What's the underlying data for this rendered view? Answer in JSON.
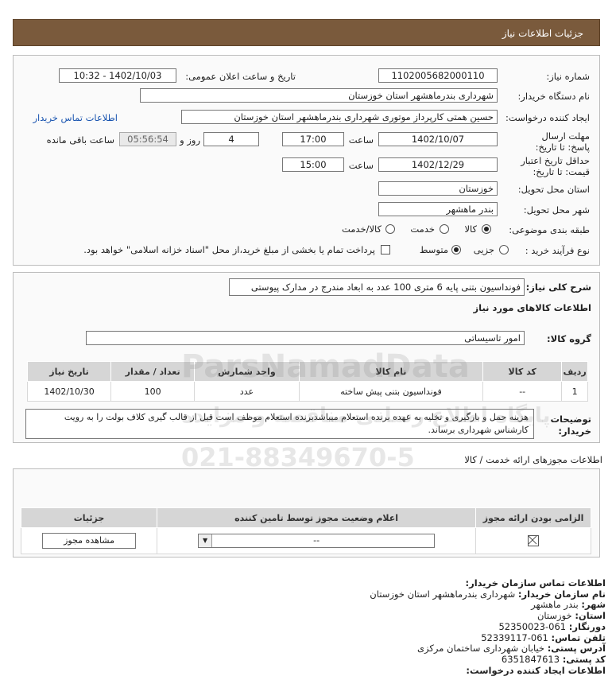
{
  "header": {
    "title": "جزئیات اطلاعات نیاز"
  },
  "details": {
    "need_number_label": "شماره نیاز:",
    "need_number": "1102005682000110",
    "announce_label": "تاریخ و ساعت اعلان عمومی:",
    "announce_value": "1402/10/03 - 10:32",
    "buyer_org_label": "نام دستگاه خریدار:",
    "buyer_org": "شهرداری بندرماهشهر استان خوزستان",
    "creator_label": "ایجاد کننده درخواست:",
    "creator": "حسین همتی کارپرداز موتوری شهرداری بندرماهشهر استان خوزستان",
    "buyer_contact_link": "اطلاعات تماس خریدار",
    "reply_deadline_label": "مهلت ارسال پاسخ: تا تاریخ:",
    "reply_date": "1402/10/07",
    "time_label": "ساعت",
    "reply_time": "17:00",
    "days": "4",
    "days_label": "روز و",
    "remaining_time": "05:56:54",
    "remaining_label": "ساعت باقی مانده",
    "price_validity_label": "حداقل تاریخ اعتبار قیمت: تا تاریخ:",
    "validity_date": "1402/12/29",
    "validity_time": "15:00",
    "province_label": "استان محل تحویل:",
    "province": "خوزستان",
    "city_label": "شهر محل تحویل:",
    "city": "بندر ماهشهر",
    "category_label": "طبقه بندی موضوعی:",
    "category_options": [
      "کالا",
      "خدمت",
      "کالا/خدمت"
    ],
    "category_selected": "کالا",
    "process_label": "نوع فرآیند خرید :",
    "process_options": [
      "جزیی",
      "متوسط"
    ],
    "process_selected": "متوسط",
    "treasury_note": "پرداخت تمام یا بخشی از مبلغ خرید،از محل \"اسناد خزانه اسلامی\" خواهد بود."
  },
  "description": {
    "summary_label": "شرح کلی نیاز:",
    "summary": "فونداسیون بتنی پایه 6 متری 100 عدد به ابعاد مندرج در مدارک پیوستی",
    "goods_info_title": "اطلاعات کالاهای مورد نیاز",
    "goods_group_label": "گروه کالا:",
    "goods_group": "امور تاسیساتی"
  },
  "goods_table": {
    "headers": [
      "ردیف",
      "کد کالا",
      "نام کالا",
      "واحد شمارش",
      "تعداد / مقدار",
      "تاریخ نیاز"
    ],
    "rows": [
      [
        "1",
        "--",
        "فونداسیون بتنی پیش ساخته",
        "عدد",
        "100",
        "1402/10/30"
      ]
    ]
  },
  "buyer_notes": {
    "label": "توضیحات خریدار:",
    "text": "هزینه حمل و بارگیری و تخلیه به عهده برنده استعلام میباشدبرنده استعلام موظف است قبل از قالب گیری کلاف بولت را به رویت کارشناس شهرداری برساند."
  },
  "licenses": {
    "title": "اطلاعات مجوزهای ارائه خدمت / کالا",
    "headers": [
      "الزامی بودن ارائه مجوز",
      "اعلام وضعیت مجوز توسط تامین کننده",
      "جزئیات"
    ],
    "status_select": "--",
    "view_button": "مشاهده مجوز"
  },
  "contact": {
    "title": "اطلاعات تماس سازمان خریدار:",
    "org_label": "نام سازمان خریدار:",
    "org": "شهرداری بندرماهشهر استان خوزستان",
    "city_label": "شهر:",
    "city": "بندر ماهشهر",
    "province_label": "استان:",
    "province": "خوزستان",
    "fax_label": "دورنگار:",
    "fax": "061-52350023",
    "phone_label": "تلفن تماس:",
    "phone": "061-52339117",
    "address_label": "آدرس پستی:",
    "address": "خیابان شهرداری ساختمان مرکزی",
    "postal_label": "کد پستی:",
    "postal": "6351847613",
    "creator_partial": "اطلاعات ایجاد کننده درخواست:"
  },
  "watermark": {
    "brand": "ParsNamadData",
    "tagline": "پایگاه اطلاع رسانی مناقصه و مزایده",
    "phone": "021-88349670-5"
  }
}
